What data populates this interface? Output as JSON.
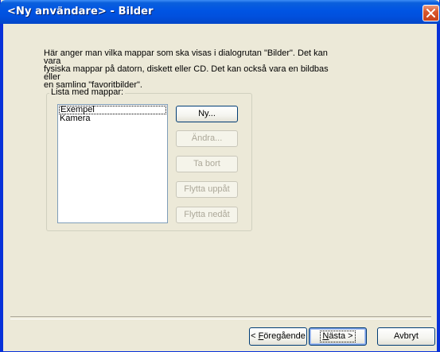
{
  "window": {
    "title": "<Ny användare> - Bilder"
  },
  "description": "Här anger man vilka mappar som ska visas i dialogrutan \"Bilder\". Det kan vara\nfysiska mappar på datorn, diskett eller CD. Det kan också vara en bildbas eller\nen samling \"favoritbilder\".",
  "folder_group": {
    "legend": "Lista med mappar:",
    "items": [
      "Exempel",
      "Kamera"
    ],
    "focused_index": 0
  },
  "buttons": {
    "new": "Ny...",
    "edit": "Ändra...",
    "remove": "Ta bort",
    "move_up": "Flytta uppåt",
    "move_down": "Flytta nedåt"
  },
  "navigation": {
    "back_prefix": "< ",
    "back_accel": "F",
    "back_rest": "öregående",
    "next_accel": "N",
    "next_rest": "ästa >",
    "cancel": "Avbryt"
  },
  "icons": {
    "close": "close-x-icon"
  },
  "colors": {
    "titlebar": "#0054e3",
    "dialog_bg": "#ece9d8",
    "close_button": "#d9582d",
    "disabled_text": "#aca899"
  }
}
